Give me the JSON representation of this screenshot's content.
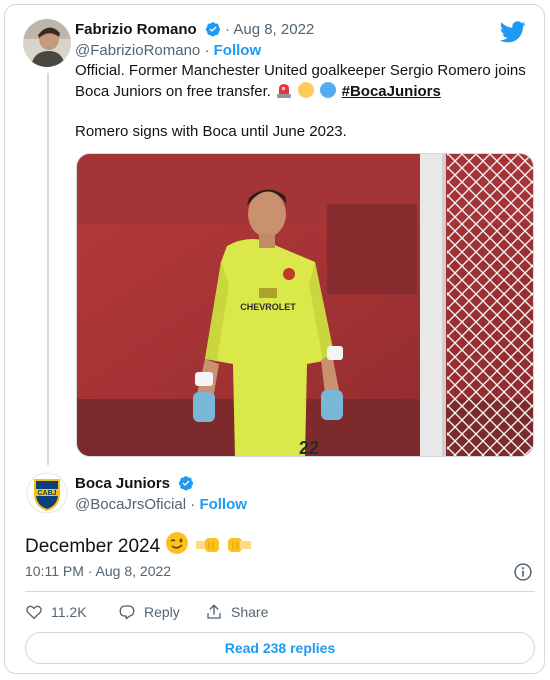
{
  "colors": {
    "accent": "#1d9bf0",
    "text": "#0f1419",
    "muted": "#536471",
    "border": "#cfd9de"
  },
  "quoted_tweet": {
    "author": {
      "display_name": "Fabrizio Romano",
      "handle": "@FabrizioRomano",
      "follow_label": "Follow",
      "verified": true
    },
    "separator": "·",
    "date": "Aug 8, 2022",
    "text_line1": "Official. Former Manchester United goalkeeper Sergio Romero joins",
    "text_line2_prefix": "Boca Juniors on free transfer.",
    "emojis": [
      "siren-emoji",
      "yellow-circle-emoji",
      "blue-circle-emoji"
    ],
    "hashtag": "#BocaJuniors",
    "text_line3": "Romero signs with Boca until June 2023.",
    "photo": {
      "jersey_sponsor": "CHEVROLET",
      "jersey_number": "22"
    }
  },
  "main_tweet": {
    "author": {
      "display_name": "Boca Juniors",
      "handle": "@BocaJrsOficial",
      "follow_label": "Follow",
      "verified": true,
      "avatar_text": "CABJ"
    },
    "text": "December 2024",
    "emojis": [
      "winking-face-emoji",
      "right-facing-fist-emoji",
      "left-facing-fist-emoji"
    ],
    "timestamp": "10:11 PM · Aug 8, 2022"
  },
  "actions": {
    "likes": "11.2K",
    "reply_label": "Reply",
    "share_label": "Share",
    "read_replies_label": "Read 238 replies"
  }
}
